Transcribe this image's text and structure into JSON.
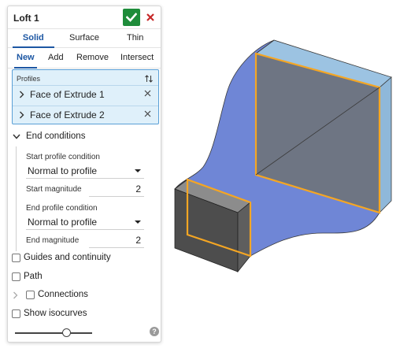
{
  "dialog": {
    "title": "Loft 1",
    "ok_icon": "checkmark-icon",
    "cancel_icon": "close-icon"
  },
  "type_tabs": [
    "Solid",
    "Surface",
    "Thin"
  ],
  "type_tabs_active": "Solid",
  "operation_tabs": [
    "New",
    "Add",
    "Remove",
    "Intersect"
  ],
  "operation_tabs_active": "New",
  "profiles": {
    "label": "Profiles",
    "items": [
      "Face of Extrude 1",
      "Face of Extrude 2"
    ]
  },
  "end_conditions": {
    "label": "End conditions",
    "expanded": true,
    "start_profile_label": "Start profile condition",
    "start_profile_value": "Normal to profile",
    "start_magnitude_label": "Start magnitude",
    "start_magnitude_value": "2",
    "end_profile_label": "End profile condition",
    "end_profile_value": "Normal to profile",
    "end_magnitude_label": "End magnitude",
    "end_magnitude_value": "2"
  },
  "options": {
    "guides": "Guides and continuity",
    "path": "Path",
    "connections": "Connections",
    "isocurves": "Show isocurves"
  },
  "slider_level": 0.67,
  "colors": {
    "accent": "#1d57a3",
    "ok_green": "#1e8c3a",
    "cancel_red": "#c62828",
    "selection_orange": "#f5a623",
    "loft_blue": "#6f86d6",
    "extrude_gray": "#5a5a5a"
  }
}
